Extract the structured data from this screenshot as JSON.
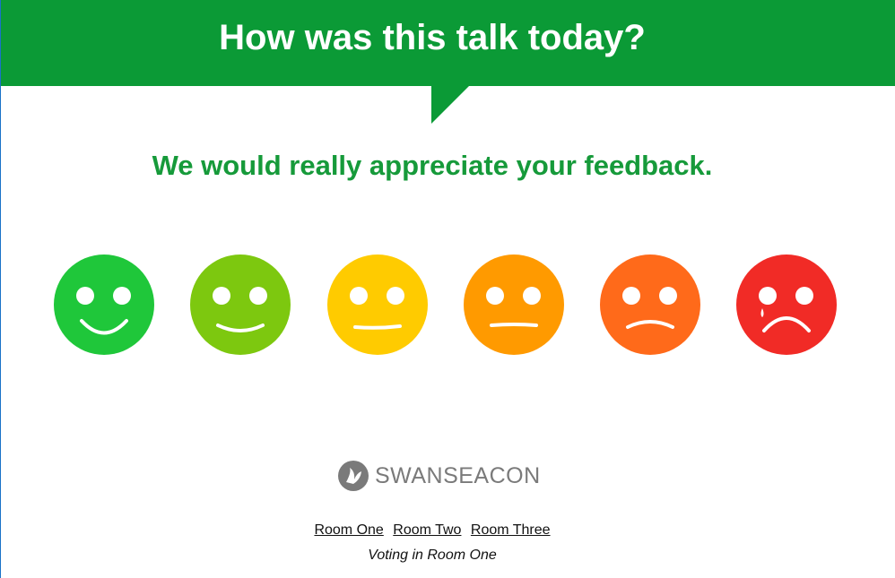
{
  "header": {
    "title": "How was this talk today?",
    "color": "#0b9a36"
  },
  "subtitle": "We would really appreciate your feedback.",
  "faces": [
    {
      "name": "very-happy",
      "color": "#1fc73a"
    },
    {
      "name": "happy",
      "color": "#7dc80f"
    },
    {
      "name": "neutral",
      "color": "#ffcb00"
    },
    {
      "name": "meh",
      "color": "#ff9a00"
    },
    {
      "name": "sad",
      "color": "#ff6a1a"
    },
    {
      "name": "very-sad",
      "color": "#f12b26"
    }
  ],
  "logo": {
    "text": "SWANSEACON",
    "color": "#7a7a7a"
  },
  "rooms": {
    "room_one": "Room One",
    "room_two": "Room Two",
    "room_three": "Room Three"
  },
  "status": "Voting in Room One"
}
